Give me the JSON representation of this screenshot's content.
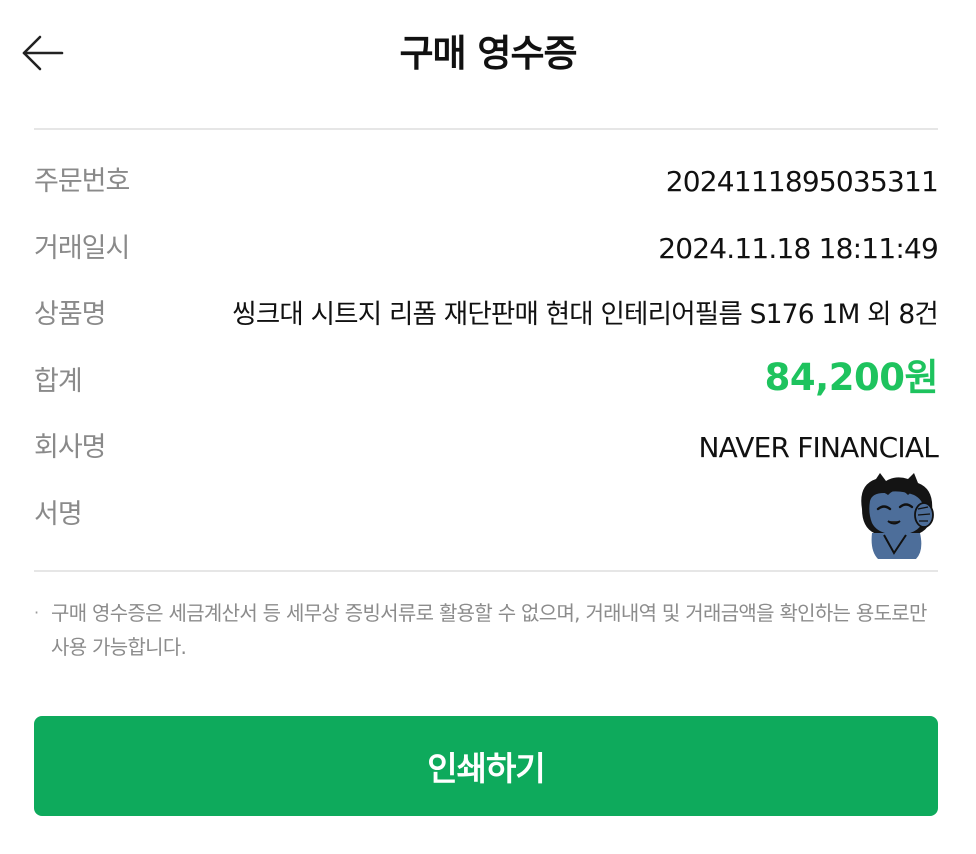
{
  "header": {
    "title": "구매 영수증",
    "back_icon": "arrow-left-icon"
  },
  "receipt": {
    "rows": [
      {
        "label": "주문번호",
        "value": "2024111895035311"
      },
      {
        "label": "거래일시",
        "value": "2024.11.18 18:11:49"
      },
      {
        "label": "상품명",
        "value": "씽크대 시트지 리폼 재단판매 현대 인테리어필름 S176 1M 외 8건"
      },
      {
        "label": "합계",
        "value": "84,200원"
      },
      {
        "label": "회사명",
        "value": "NAVER FINANCIAL"
      },
      {
        "label": "서명",
        "value": ""
      }
    ],
    "total_color": "#1ec35e"
  },
  "notice": {
    "bullet": "·",
    "text": "구매 영수증은 세금계산서 등 세무상 증빙서류로 활용할 수 없으며, 거래내역 및 거래금액을 확인하는 용도로만 사용 가능합니다."
  },
  "actions": {
    "print_label": "인쇄하기",
    "print_color": "#0eaa5c"
  }
}
